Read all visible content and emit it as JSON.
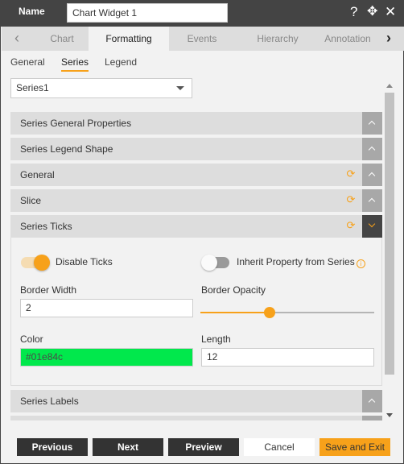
{
  "header": {
    "name_label": "Name",
    "name_value": "Chart Widget 1",
    "icons": [
      "help-icon",
      "move-icon",
      "close-icon"
    ]
  },
  "tabs": {
    "items": [
      {
        "label": "Chart",
        "active": false
      },
      {
        "label": "Formatting",
        "active": true
      },
      {
        "label": "Events",
        "active": false
      },
      {
        "label": "Hierarchy",
        "active": false
      },
      {
        "label": "Annotation",
        "active": false
      }
    ]
  },
  "subtabs": {
    "items": [
      {
        "label": "General",
        "active": false
      },
      {
        "label": "Series",
        "active": true
      },
      {
        "label": "Legend",
        "active": false
      }
    ]
  },
  "series_select": {
    "value": "Series1"
  },
  "panels": [
    {
      "title": "Series General Properties",
      "expanded": false,
      "has_reset": false
    },
    {
      "title": "Series Legend Shape",
      "expanded": false,
      "has_reset": false
    },
    {
      "title": "General",
      "expanded": false,
      "has_reset": true
    },
    {
      "title": "Slice",
      "expanded": false,
      "has_reset": true
    },
    {
      "title": "Series Ticks",
      "expanded": true,
      "has_reset": true
    },
    {
      "title": "Series Labels",
      "expanded": false,
      "has_reset": false
    }
  ],
  "series_ticks": {
    "disable_ticks": {
      "label": "Disable Ticks",
      "on": true
    },
    "inherit_property": {
      "label": "Inherit Property from Series",
      "on": false
    },
    "border_width": {
      "label": "Border Width",
      "value": "2"
    },
    "border_opacity": {
      "label": "Border Opacity",
      "percent": 40
    },
    "color": {
      "label": "Color",
      "value": "#01e84c",
      "swatch": "#01e84c"
    },
    "length": {
      "label": "Length",
      "value": "12"
    }
  },
  "footer": {
    "previous": "Previous",
    "next": "Next",
    "preview": "Preview",
    "cancel": "Cancel",
    "save_exit": "Save and Exit"
  },
  "colors": {
    "accent": "#f7a11a",
    "header_bg": "#444444",
    "dark_button": "#333333"
  }
}
